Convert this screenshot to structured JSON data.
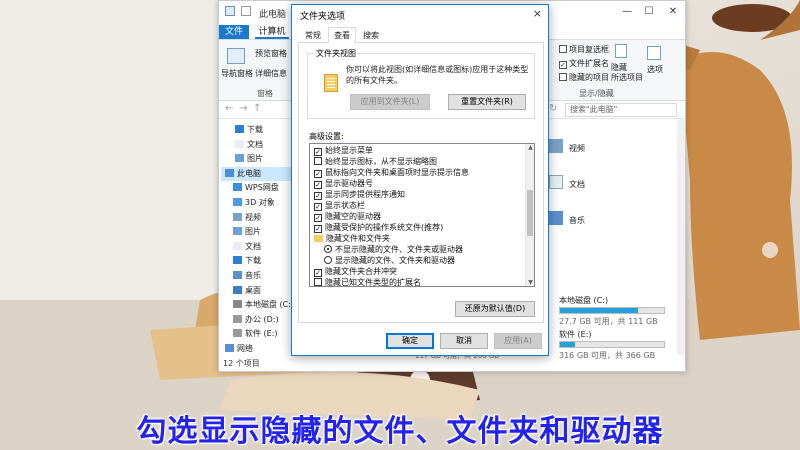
{
  "explorer": {
    "title": "此电脑",
    "tabs": {
      "file": "文件",
      "computer": "计算机"
    },
    "ribbon": {
      "nav_pane": "导航窗格",
      "preview_pane": "预览窗格",
      "details_pane": "详细信息",
      "pane_group": "窗格",
      "item_checkboxes": "项目复选框",
      "file_extensions": "文件扩展名",
      "hidden_items": "隐藏的项目",
      "hide": "隐藏",
      "hide_selected": "所选项目",
      "options": "选项",
      "show_hide_group": "显示/隐藏"
    },
    "search_placeholder": "搜索\"此电脑\"",
    "nav": [
      "下载",
      "文档",
      "图片",
      "此电脑",
      "WPS网盘",
      "3D 对象",
      "视频",
      "图片",
      "文档",
      "下载",
      "音乐",
      "桌面",
      "本地磁盘 (C:)",
      "办公 (D:)",
      "软件 (E:)",
      "网络"
    ],
    "right": {
      "videos": "视频",
      "documents": "文档",
      "music": "音乐",
      "drive_c": "本地磁盘 (C:)",
      "drive_c_free": "27.7 GB 可用，共 111 GB",
      "drive_e": "软件 (E:)",
      "drive_e_free": "316 GB 可用，共 366 GB",
      "drive_c_used_pct": 75,
      "drive_e_used_pct": 14
    },
    "middle_partial": "117 GB 可用，共 200 GB",
    "status": "12 个项目"
  },
  "dialog": {
    "title": "文件夹选项",
    "close_icon": "×",
    "tabs": [
      "常规",
      "查看",
      "搜索"
    ],
    "active_tab": 1,
    "folder_view": {
      "legend": "文件夹视图",
      "desc": "你可以将此视图(如详细信息或图标)应用于这种类型的所有文件夹。",
      "apply_btn": "应用到文件夹(L)",
      "reset_btn": "重置文件夹(R)"
    },
    "advanced_label": "高级设置:",
    "settings": [
      {
        "type": "check",
        "checked": true,
        "indent": 0,
        "label": "始终显示菜单"
      },
      {
        "type": "check",
        "checked": false,
        "indent": 0,
        "label": "始终显示图标，从不显示缩略图"
      },
      {
        "type": "check",
        "checked": true,
        "indent": 0,
        "label": "鼠标指向文件夹和桌面项时显示提示信息"
      },
      {
        "type": "check",
        "checked": true,
        "indent": 0,
        "label": "显示驱动器号"
      },
      {
        "type": "check",
        "checked": true,
        "indent": 0,
        "label": "显示同步提供程序通知"
      },
      {
        "type": "check",
        "checked": true,
        "indent": 0,
        "label": "显示状态栏"
      },
      {
        "type": "check",
        "checked": true,
        "indent": 0,
        "label": "隐藏空的驱动器"
      },
      {
        "type": "check",
        "checked": true,
        "indent": 0,
        "label": "隐藏受保护的操作系统文件(推荐)"
      },
      {
        "type": "folder",
        "checked": false,
        "indent": 0,
        "label": "隐藏文件和文件夹"
      },
      {
        "type": "radio",
        "checked": true,
        "indent": 1,
        "label": "不显示隐藏的文件、文件夹或驱动器"
      },
      {
        "type": "radio",
        "checked": false,
        "indent": 1,
        "label": "显示隐藏的文件、文件夹和驱动器"
      },
      {
        "type": "check",
        "checked": true,
        "indent": 0,
        "label": "隐藏文件夹合并冲突"
      },
      {
        "type": "check",
        "checked": false,
        "indent": 0,
        "label": "隐藏已知文件类型的扩展名"
      }
    ],
    "restore_btn": "还原为默认值(D)",
    "ok_btn": "确定",
    "cancel_btn": "取消",
    "apply_btn": "应用(A)"
  },
  "caption": "勾选显示隐藏的文件、文件夹和驱动器",
  "colors": {
    "accent": "#1979ca",
    "caption": "#2323ea",
    "drive_bar": "#26a0da"
  }
}
